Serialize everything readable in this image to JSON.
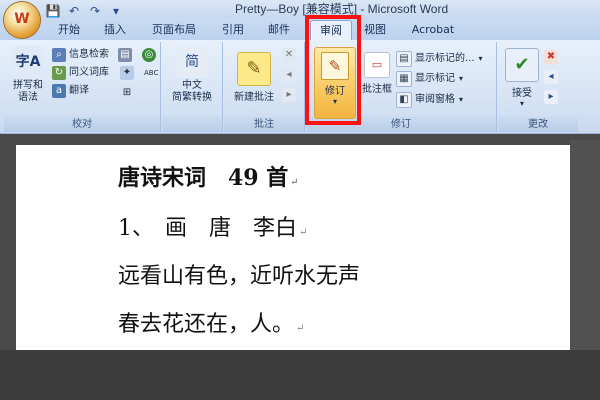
{
  "window": {
    "title": "Pretty—Boy [兼容模式] - Microsoft Word",
    "office_button_glyph": "W"
  },
  "qat": {
    "save_glyph": "💾",
    "undo_glyph": "↶",
    "redo_glyph": "↷",
    "more_glyph": "▾"
  },
  "tabs": [
    "开始",
    "插入",
    "页面布局",
    "引用",
    "邮件",
    "审阅",
    "视图",
    "Acrobat"
  ],
  "active_tab": "审阅",
  "ribbon": {
    "proofing": {
      "label": "校对",
      "spelling_label": "拼写和\n语法",
      "research": "信息检索",
      "thesaurus": "同义词库",
      "translate": "翻译"
    },
    "chinese": {
      "label": "",
      "convert_label": "中文\n简繁转换",
      "big_glyph": "简"
    },
    "comments": {
      "label": "批注",
      "new_comment": "新建批注"
    },
    "tracking": {
      "label": "修订",
      "track_changes": "修订",
      "balloons": "批注框",
      "show_markup": "显示标记的...",
      "show_markup_menu": "显示标记",
      "reviewing_pane": "审阅窗格"
    },
    "changes": {
      "label": "更改",
      "accept": "接受"
    }
  },
  "document": {
    "lines": [
      "唐诗宋词　49 首",
      "1、　画　唐　李白",
      "远看山有色，近听水无声",
      "春去花还在，人。"
    ],
    "pilcrow": "↵"
  },
  "colors": {
    "highlight": "#ff1111",
    "ribbon_bg": "#d7e4f5",
    "active_tab_bg": "#e8f0fb"
  }
}
